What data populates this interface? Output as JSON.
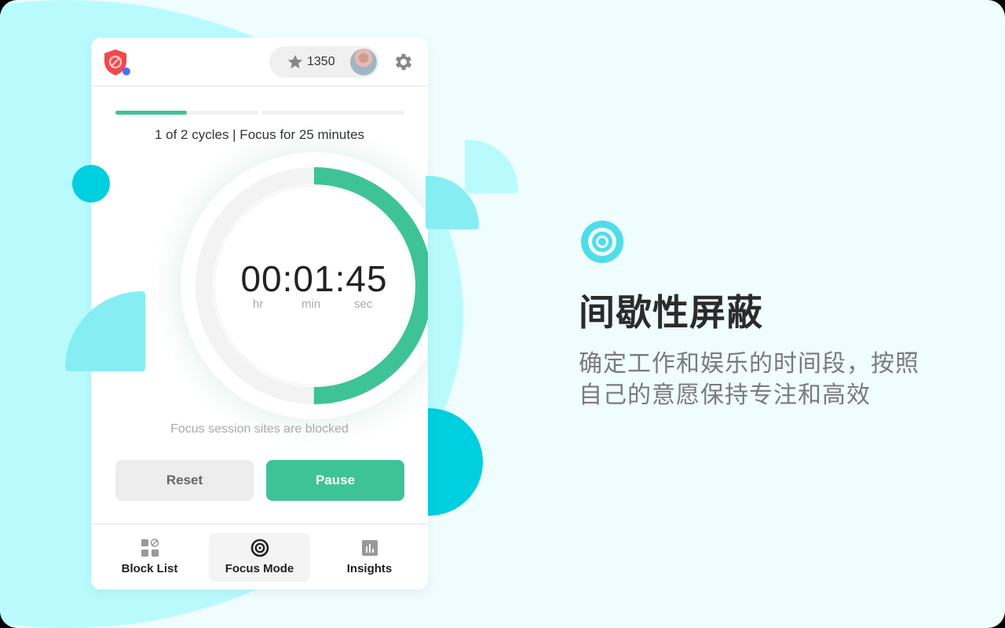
{
  "header": {
    "points": "1350",
    "logo_icon": "shield-block-icon",
    "star_icon": "star-icon",
    "avatar": "user-avatar",
    "settings_icon": "gear-icon"
  },
  "session": {
    "cycles_progress": {
      "current": 1,
      "total": 2,
      "current_cycle_fraction": 0.5
    },
    "cycles_text": "1 of 2 cycles | Focus for 25 minutes",
    "timer_display": "00:01:45",
    "timer_progress_fraction": 0.5,
    "units": {
      "hr": "hr",
      "min": "min",
      "sec": "sec"
    },
    "blocked_text": "Focus session sites are blocked"
  },
  "buttons": {
    "reset": "Reset",
    "pause": "Pause"
  },
  "nav": {
    "items": [
      {
        "label": "Block List",
        "icon": "block-list-icon",
        "active": false
      },
      {
        "label": "Focus Mode",
        "icon": "target-icon",
        "active": true
      },
      {
        "label": "Insights",
        "icon": "insights-icon",
        "active": false
      }
    ]
  },
  "feature": {
    "icon": "target-icon",
    "title": "间歇性屏蔽",
    "description": "确定工作和娱乐的时间段，按照自己的意愿保持专注和高效"
  },
  "colors": {
    "accent": "#3ec396",
    "logo": "#f0484b",
    "badge": "#4f6ef7",
    "teal": "#00cfe0",
    "light_teal": "#86eef2"
  }
}
